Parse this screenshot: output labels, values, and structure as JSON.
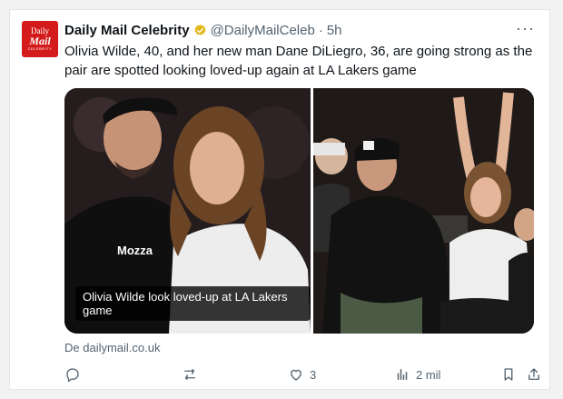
{
  "tweet": {
    "author_name": "Daily Mail Celebrity",
    "handle": "@DailyMailCeleb",
    "separator": "·",
    "time": "5h",
    "more": "···",
    "text": "Olivia Wilde, 40, and her new man Dane DiLiegro, 36, are going strong as the pair are spotted looking loved-up again at LA Lakers game",
    "media_caption": "Olivia Wilde look loved-up at LA Lakers game",
    "source": "De dailymail.co.uk",
    "avatar": {
      "line1": "Daily",
      "line2": "Mail",
      "line3": "CELEBRITY"
    },
    "verified_badge": "verified-badge-gold",
    "actions": {
      "reply_count": "",
      "repost_count": "",
      "like_count": "3",
      "views_count": "2 mil"
    }
  },
  "colors": {
    "brand_red": "#d31b1b",
    "text": "#0f1419",
    "muted": "#536471",
    "verified_gold": "#e2b719"
  }
}
